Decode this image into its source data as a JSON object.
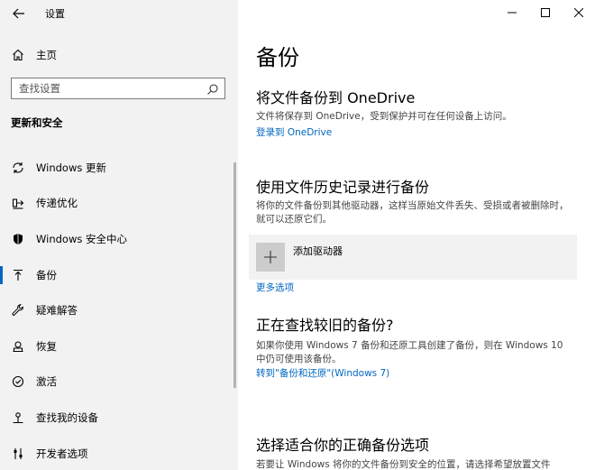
{
  "window": {
    "app_title": "设置"
  },
  "sidebar": {
    "home_label": "主页",
    "search_placeholder": "查找设置",
    "section_title": "更新和安全",
    "items": [
      {
        "label": "Windows 更新",
        "icon": "sync-icon"
      },
      {
        "label": "传递优化",
        "icon": "delivery-optimization-icon"
      },
      {
        "label": "Windows 安全中心",
        "icon": "shield-icon"
      },
      {
        "label": "备份",
        "icon": "backup-arrow-icon",
        "active": true
      },
      {
        "label": "疑难解答",
        "icon": "wrench-icon"
      },
      {
        "label": "恢复",
        "icon": "recovery-icon"
      },
      {
        "label": "激活",
        "icon": "activation-check-icon"
      },
      {
        "label": "查找我的设备",
        "icon": "find-device-icon"
      },
      {
        "label": "开发者选项",
        "icon": "developer-sliders-icon"
      }
    ]
  },
  "main": {
    "title": "备份",
    "onedrive": {
      "heading": "将文件备份到 OneDrive",
      "description": "文件将保存到 OneDrive，受到保护并可在任何设备上访问。",
      "link": "登录到 OneDrive"
    },
    "file_history": {
      "heading": "使用文件历史记录进行备份",
      "description": "将你的文件备份到其他驱动器，这样当原始文件丢失、受损或者被删除时，就可以还原它们。",
      "add_drive_label": "添加驱动器",
      "more_options_link": "更多选项"
    },
    "older_backup": {
      "heading": "正在查找较旧的备份?",
      "description": "如果你使用 Windows 7 备份和还原工具创建了备份，则在 Windows 10 中仍可使用该备份。",
      "link": "转到\"备份和还原\"(Windows 7)"
    },
    "choose": {
      "heading": "选择适合你的正确备份选项",
      "description": "若要让 Windows 将你的文件备份到安全的位置，请选择希望放置文件"
    }
  },
  "colors": {
    "accent": "#0067c0",
    "sidebar_bg": "#f2f2f2"
  }
}
